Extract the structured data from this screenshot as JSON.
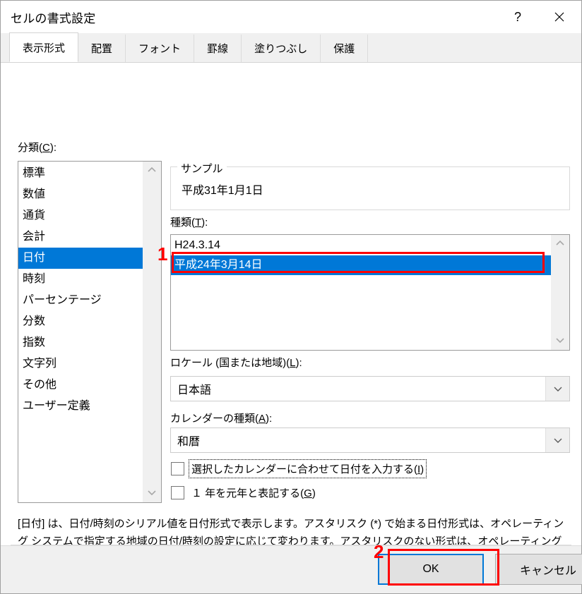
{
  "window": {
    "title": "セルの書式設定",
    "help_icon": "question-mark-icon",
    "help_label": "?",
    "close_icon": "close-icon"
  },
  "tabs": [
    {
      "label": "表示形式",
      "active": true
    },
    {
      "label": "配置",
      "active": false
    },
    {
      "label": "フォント",
      "active": false
    },
    {
      "label": "罫線",
      "active": false
    },
    {
      "label": "塗りつぶし",
      "active": false
    },
    {
      "label": "保護",
      "active": false
    }
  ],
  "category": {
    "label": "分類(C):",
    "label_text": "分類(",
    "accel": "C",
    "label_tail": "):",
    "items": [
      "標準",
      "数値",
      "通貨",
      "会計",
      "日付",
      "時刻",
      "パーセンテージ",
      "分数",
      "指数",
      "文字列",
      "その他",
      "ユーザー定義"
    ],
    "selected": "日付",
    "scroll_up_icon": "chevron-up-icon",
    "scroll_down_icon": "chevron-down-icon"
  },
  "sample": {
    "legend": "サンプル",
    "value": "平成31年1月1日"
  },
  "type": {
    "label_text": "種類(",
    "accel": "T",
    "label_tail": "):",
    "items": [
      "H24.3.14",
      "平成24年3月14日"
    ],
    "selected": "平成24年3月14日",
    "scroll_up_icon": "chevron-up-icon",
    "scroll_down_icon": "chevron-down-icon"
  },
  "locale": {
    "label_text": "ロケール (国または地域)(",
    "accel": "L",
    "label_tail": "):",
    "value": "日本語",
    "dropdown_icon": "chevron-down-icon"
  },
  "calendar": {
    "label_text": "カレンダーの種類(",
    "accel": "A",
    "label_tail": "):",
    "value": "和暦",
    "dropdown_icon": "chevron-down-icon"
  },
  "checkboxes": [
    {
      "label_text": "選択したカレンダーに合わせて日付を入力する(",
      "accel": "I",
      "label_tail": ")",
      "checked": false,
      "focused": true
    },
    {
      "label_text": "１ 年を元年と表記する(",
      "accel": "G",
      "label_tail": ")",
      "checked": false,
      "focused": false
    }
  ],
  "description": "[日付] は、日付/時刻のシリアル値を日付形式で表示します。アスタリスク (*) で始まる日付形式は、オペレーティング システムで指定する地域の日付/時刻の設定に応じて変わります。アスタリスクのない形式は、オペレーティング システムの設定が変わってもそのままです。",
  "footer": {
    "ok_label": "OK",
    "cancel_label": "キャンセル"
  },
  "annotations": [
    {
      "number": "1",
      "target": "type-list-selected-item"
    },
    {
      "number": "2",
      "target": "ok-button"
    }
  ],
  "colors": {
    "selection_blue": "#0078d7",
    "annotation_red": "#ff0000",
    "dialog_bg": "#ffffff",
    "footer_bg": "#f0f0f0"
  }
}
